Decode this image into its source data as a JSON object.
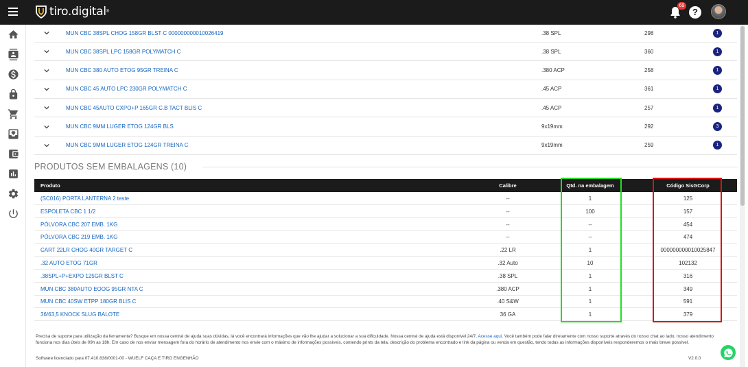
{
  "header": {
    "logo_text": "tiro.digital",
    "logo_reg": "®",
    "notification_count": "69",
    "help_label": "?"
  },
  "sidebar": {
    "items": [
      {
        "icon": "home-icon"
      },
      {
        "icon": "contacts-icon"
      },
      {
        "icon": "dollar-icon"
      },
      {
        "icon": "lock-icon"
      },
      {
        "icon": "cart-icon"
      },
      {
        "icon": "inbox-icon"
      },
      {
        "icon": "wallet-icon"
      },
      {
        "icon": "chart-icon"
      },
      {
        "icon": "gear-icon"
      },
      {
        "icon": "power-icon"
      }
    ]
  },
  "packaged_products": [
    {
      "name": "MUN CBC 38SPL CHOG 158GR BLST C 000000000010026419",
      "caliber": ".38 SPL",
      "code": "298",
      "count": "1"
    },
    {
      "name": "MUN CBC 38SPL LPC 158GR POLYMATCH C",
      "caliber": ".38 SPL",
      "code": "360",
      "count": "1"
    },
    {
      "name": "MUN CBC 380 AUTO ETOG 95GR TREINA C",
      "caliber": ".380 ACP",
      "code": "258",
      "count": "1"
    },
    {
      "name": "MUN CBC 45 AUTO LPC 230GR POLYMATCH C",
      "caliber": ".45 ACP",
      "code": "361",
      "count": "1"
    },
    {
      "name": "MUN CBC 45AUTO CXPO+P 165GR C.B TACT BLIS C",
      "caliber": ".45 ACP",
      "code": "257",
      "count": "1"
    },
    {
      "name": "MUN CBC 9MM LUGER ETOG 124GR BLS",
      "caliber": "9x19mm",
      "code": "292",
      "count": "3"
    },
    {
      "name": "MUN CBC 9MM LUGER ETOG 124GR TREINA C",
      "caliber": "9x19mm",
      "code": "259",
      "count": "1"
    }
  ],
  "section": {
    "title": "PRODUTOS SEM EMBALAGENS (10)"
  },
  "table": {
    "headers": {
      "produto": "Produto",
      "calibre": "Calibre",
      "qtd": "Qtd. na embalagem",
      "codigo": "Código SisGCorp"
    },
    "rows": [
      {
        "produto": "(SC016) PORTA LANTERNA 2 teste",
        "calibre": "--",
        "qtd": "1",
        "codigo": "125"
      },
      {
        "produto": "ESPOLETA CBC 1 1/2",
        "calibre": "--",
        "qtd": "100",
        "codigo": "157"
      },
      {
        "produto": "PÓLVORA CBC 207 EMB. 1KG",
        "calibre": "--",
        "qtd": "--",
        "codigo": "454"
      },
      {
        "produto": "PÓLVORA CBC 219 EMB. 1KG",
        "calibre": "--",
        "qtd": "--",
        "codigo": "474"
      },
      {
        "produto": "CART 22LR CHOG 40GR TARGET C",
        "calibre": ".22 LR",
        "qtd": "1",
        "codigo": "000000000010025847"
      },
      {
        "produto": ".32 AUTO ETOG 71GR",
        "calibre": ".32 Auto",
        "qtd": "10",
        "codigo": "102132"
      },
      {
        "produto": ".38SPL+P+EXPO 125GR BLST C",
        "calibre": ".38 SPL",
        "qtd": "1",
        "codigo": "316"
      },
      {
        "produto": "MUN CBC 380AUTO EOOG 95GR NTA C",
        "calibre": ".380 ACP",
        "qtd": "1",
        "codigo": "349"
      },
      {
        "produto": "MUN CBC 40SW ETPP 180GR BLIS C",
        "calibre": ".40 S&W",
        "qtd": "1",
        "codigo": "591"
      },
      {
        "produto": "36/63,5 KNOCK SLUG BALOTE",
        "calibre": "36 GA",
        "qtd": "1",
        "codigo": "379"
      }
    ]
  },
  "footer": {
    "text_1": "Precisa de suporte para utilização da ferramenta? Busque em nossa central de ajuda suas dúvidas, lá você encontrará informações que vão lhe ajudar a solucionar a sua dificuldade. Nossa central de ajuda está disponível 24/7.",
    "link": "Acesse aqui",
    "text_2": ". Você também pode falar diretamente com nosso suporte através do nosso chat ao lado, nosso atendimento funciona nos dias úteis de 09h as 18h. Em caso de nos enviar mensagem fora do horário de atendimento nos envie com o máximo de informações possíveis, contendo prints da tela, descrição do problema encontrado e link da página ou venda em questão, tendo todas as informações disponíveis responderemos o mais breve possível.",
    "license": "Software licenciado para 07.410.838/0001-00 - WUELF CAÇA E TIRO ENGENHÃO",
    "version": "V2.0.0"
  },
  "colors": {
    "topbar": "#1b1b1b",
    "link": "#1565c0",
    "badge": "#1a237e",
    "highlight_qtd": "#22dd22",
    "highlight_codigo": "#dd1111",
    "whatsapp": "#25d366"
  }
}
